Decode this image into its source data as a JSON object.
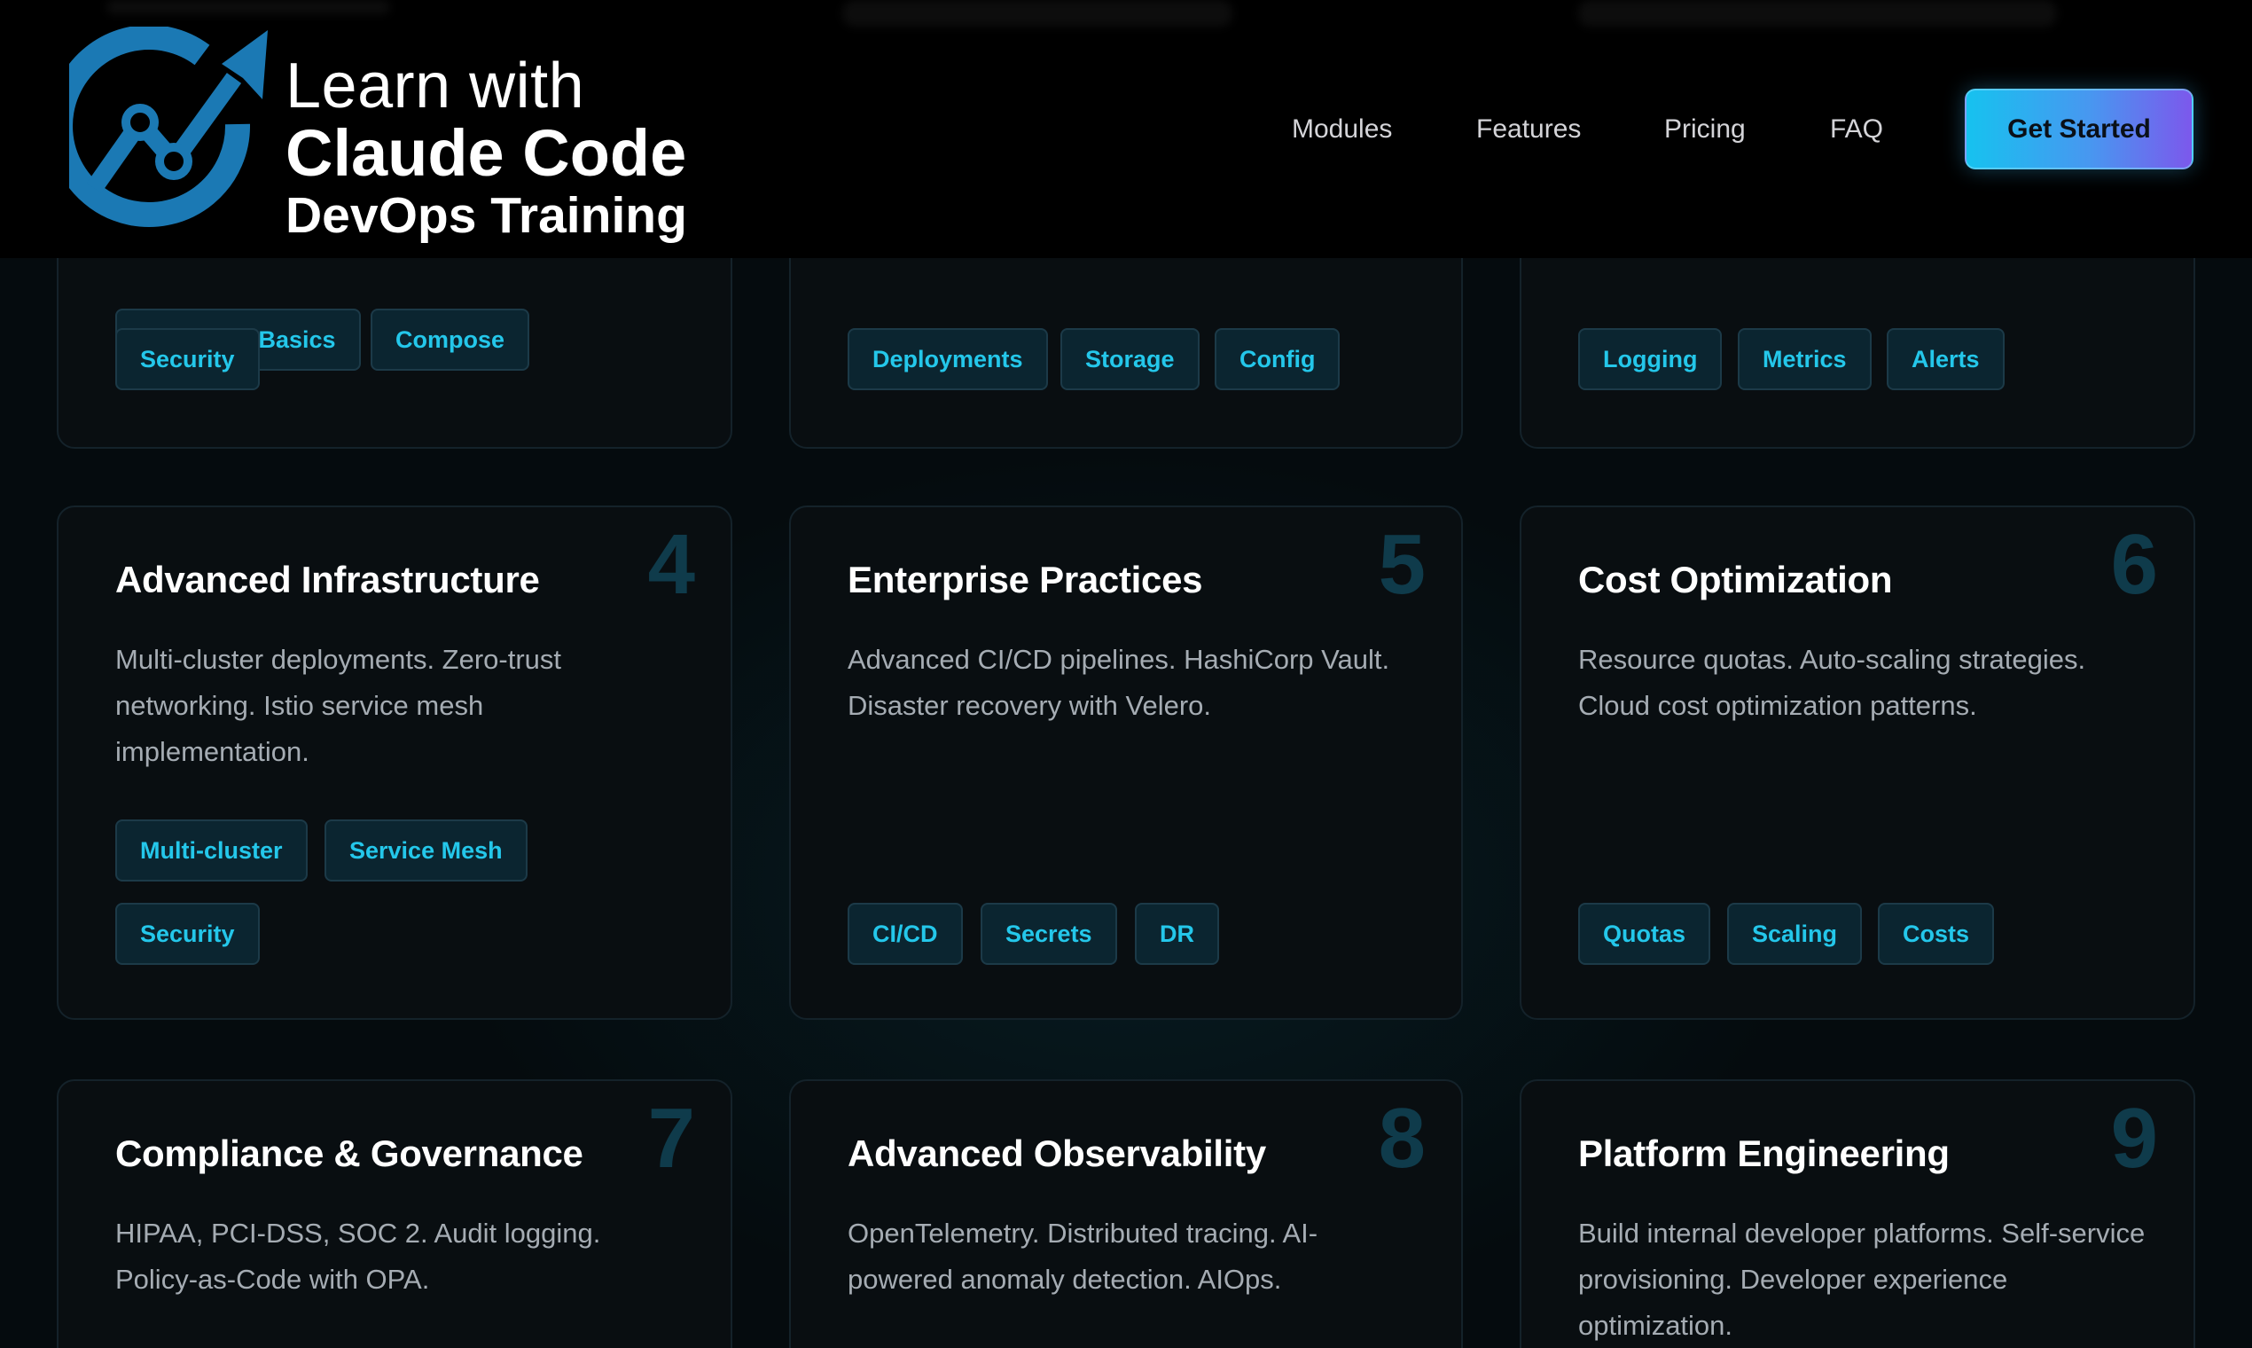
{
  "header": {
    "brand": {
      "line1": "Learn with",
      "line2": "Claude Code",
      "line3": "DevOps Training"
    },
    "nav": [
      "Modules",
      "Features",
      "Pricing",
      "FAQ"
    ],
    "cta_label": "Get Started"
  },
  "colors": {
    "accent_cyan": "#24c7ea",
    "cta_gradient_start": "#16c2ef",
    "cta_gradient_end": "#7c58ec",
    "logo_blue": "#1b79b4",
    "card_number": "#0f3b4b"
  },
  "icons": {
    "logo": "growth-arrow-circle-icon"
  },
  "cards_top": [
    {
      "tags": [
        "Container Basics",
        "Compose",
        "Security"
      ]
    },
    {
      "tags": [
        "Deployments",
        "Storage",
        "Config"
      ]
    },
    {
      "tags": [
        "Logging",
        "Metrics",
        "Alerts"
      ]
    }
  ],
  "cards": [
    {
      "number": "4",
      "title": "Advanced Infrastructure",
      "description": "Multi-cluster deployments. Zero-trust networking. Istio service mesh implementation.",
      "tags": [
        "Multi-cluster",
        "Service Mesh",
        "Security"
      ]
    },
    {
      "number": "5",
      "title": "Enterprise Practices",
      "description": "Advanced CI/CD pipelines. HashiCorp Vault. Disaster recovery with Velero.",
      "tags": [
        "CI/CD",
        "Secrets",
        "DR"
      ]
    },
    {
      "number": "6",
      "title": "Cost Optimization",
      "description": "Resource quotas. Auto-scaling strategies. Cloud cost optimization patterns.",
      "tags": [
        "Quotas",
        "Scaling",
        "Costs"
      ]
    },
    {
      "number": "7",
      "title": "Compliance & Governance",
      "description": "HIPAA, PCI-DSS, SOC 2. Audit logging. Policy-as-Code with OPA.",
      "tags": []
    },
    {
      "number": "8",
      "title": "Advanced Observability",
      "description": "OpenTelemetry. Distributed tracing. AI-powered anomaly detection. AIOps.",
      "tags": []
    },
    {
      "number": "9",
      "title": "Platform Engineering",
      "description": "Build internal developer platforms. Self-service provisioning. Developer experience optimization.",
      "tags": []
    }
  ]
}
